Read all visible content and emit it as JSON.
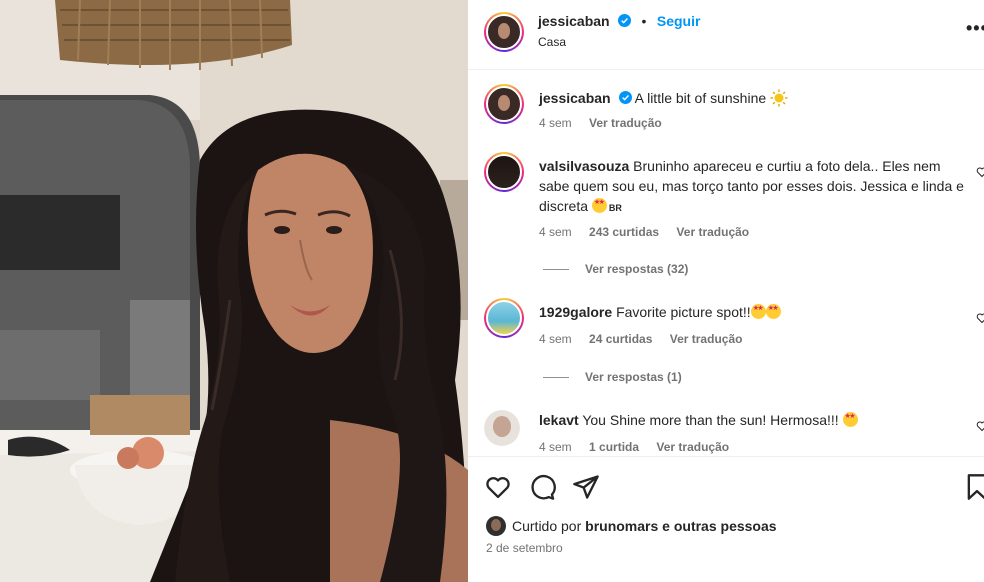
{
  "post": {
    "username": "jessicaban",
    "follow_label": "Seguir",
    "location": "Casa",
    "more_label": "•••",
    "caption": "A little bit of sunshine",
    "caption_time": "4 sem",
    "caption_translate": "Ver tradução"
  },
  "comments": [
    {
      "username": "valsilvasouza",
      "text": "Bruninho apareceu e curtiu a foto dela.. Eles nem sabe quem sou eu, mas torço tanto por esses dois. Jessica e linda e discreta",
      "suffix": "BR",
      "time": "4 sem",
      "likes": "243 curtidas",
      "translate": "Ver tradução",
      "replies": "Ver respostas (32)"
    },
    {
      "username": "1929galore",
      "text": "Favorite picture spot!!",
      "time": "4 sem",
      "likes": "24 curtidas",
      "translate": "Ver tradução",
      "replies": "Ver respostas (1)"
    },
    {
      "username": "lekavt",
      "text": "You Shine more than the sun! Hermosa!!!",
      "time": "4 sem",
      "likes": "1 curtida",
      "translate": "Ver tradução"
    }
  ],
  "footer": {
    "liked_prefix": "Curtido por",
    "liked_user": "brunomars",
    "liked_suffix": "e outras pessoas",
    "date": "2 de setembro"
  },
  "icons": [
    "verified-icon",
    "sun-emoji-icon",
    "star-eyes-emoji-icon",
    "heart-icon",
    "comment-icon",
    "share-icon",
    "bookmark-icon",
    "more-icon"
  ],
  "colors": {
    "link": "#0095f6",
    "verified": "#0095f6",
    "muted": "#737373",
    "text": "#262626"
  }
}
